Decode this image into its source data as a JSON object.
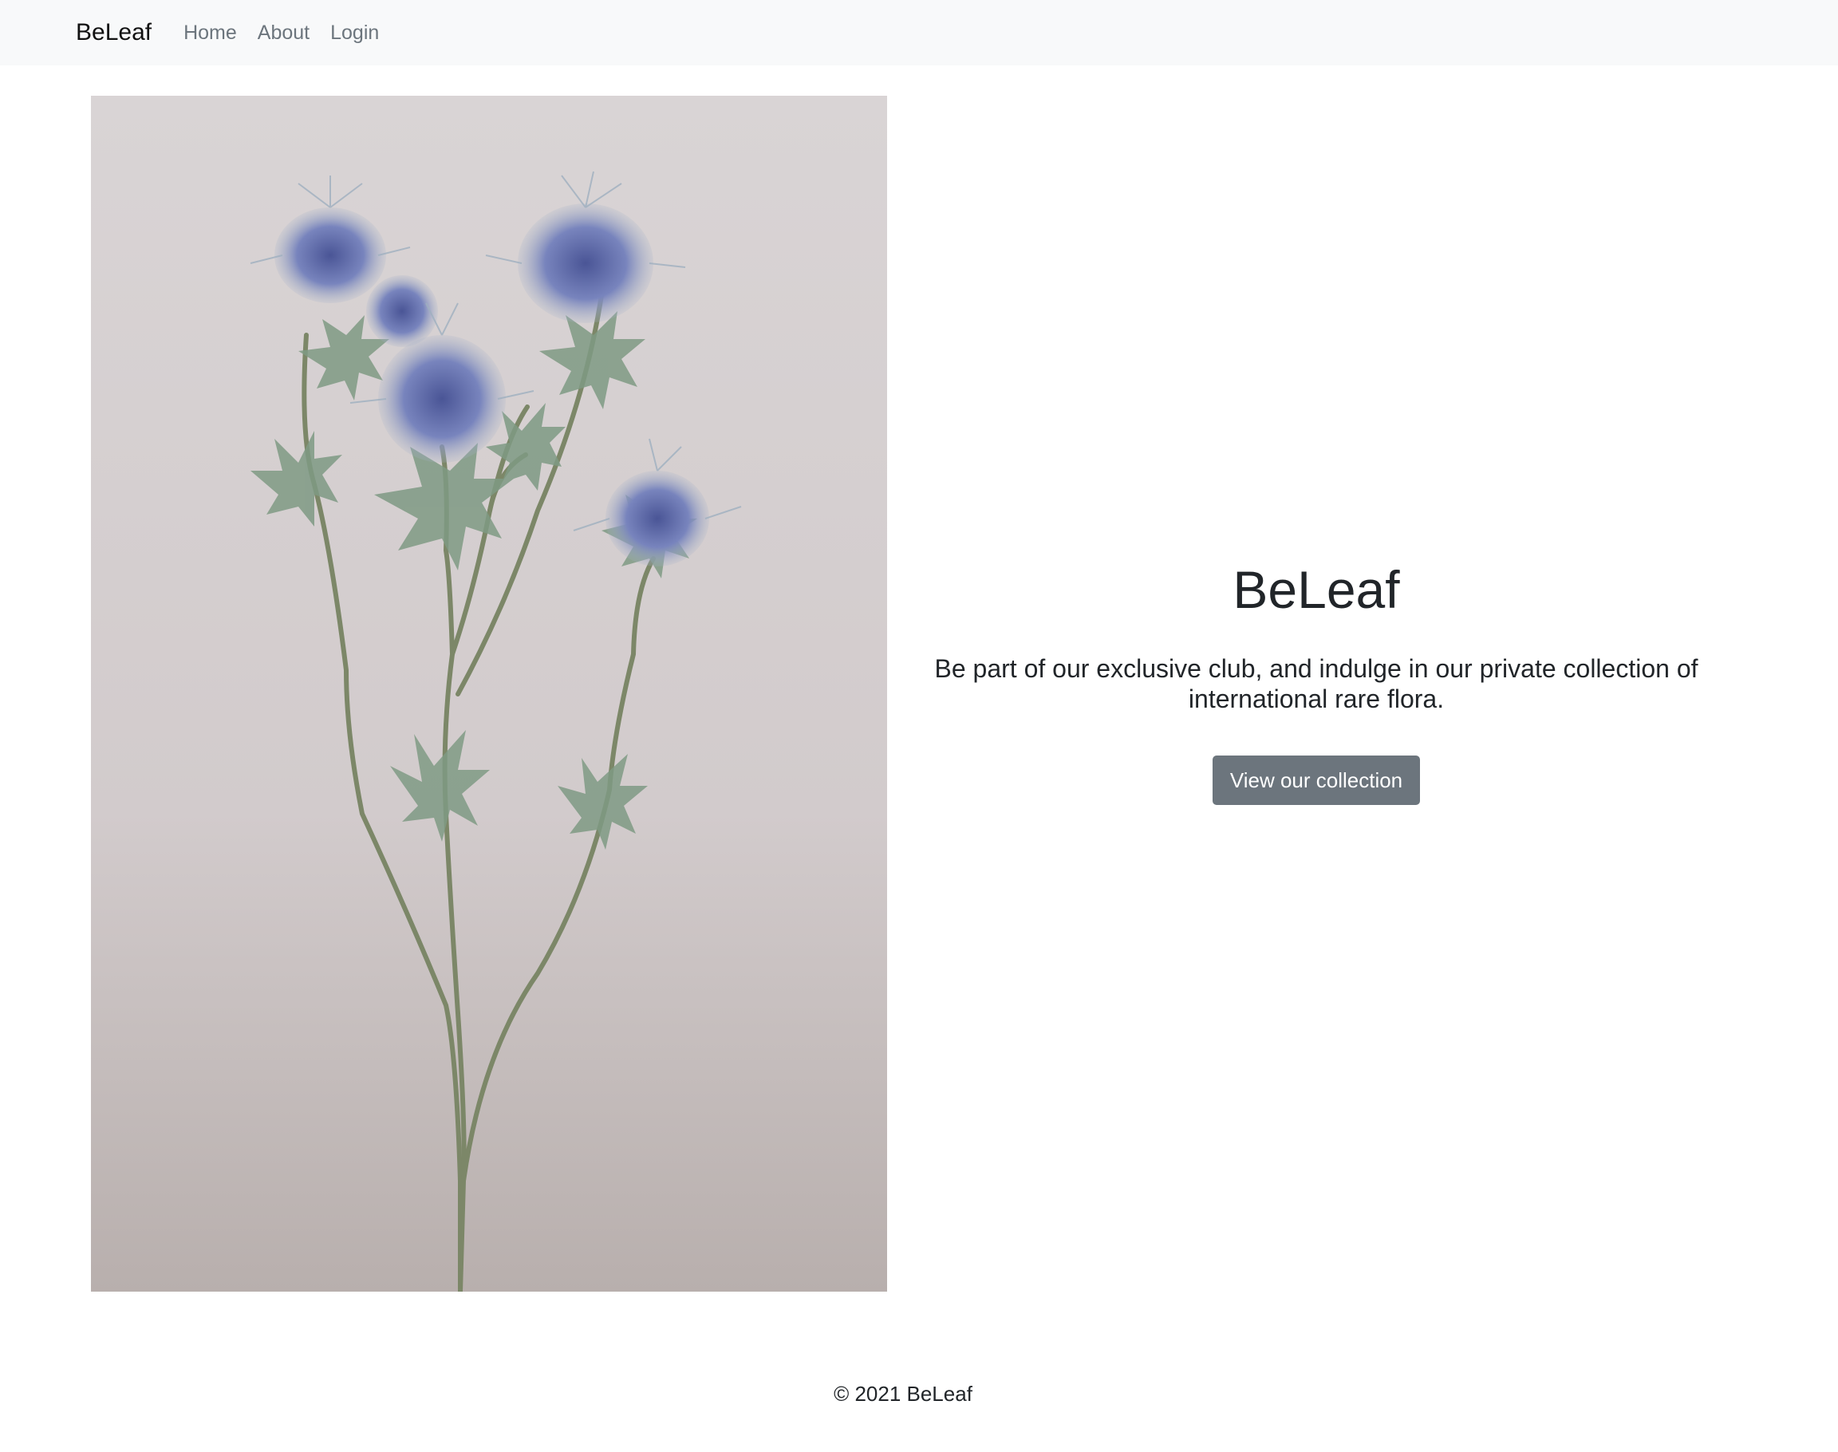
{
  "navbar": {
    "brand": "BeLeaf",
    "links": [
      {
        "label": "Home"
      },
      {
        "label": "About"
      },
      {
        "label": "Login"
      }
    ]
  },
  "hero": {
    "image_subject": "dried blue thistle flowers on a pale grey background",
    "title": "BeLeaf",
    "lead": "Be part of our exclusive club, and indulge in our private collection of international rare flora.",
    "button_label": "View our collection"
  },
  "footer": {
    "text": "© 2021 BeLeaf"
  },
  "colors": {
    "navbar_bg": "#f8f9fa",
    "button_bg": "#6c757d",
    "text": "#212529",
    "nav_link": "#6c757d"
  }
}
